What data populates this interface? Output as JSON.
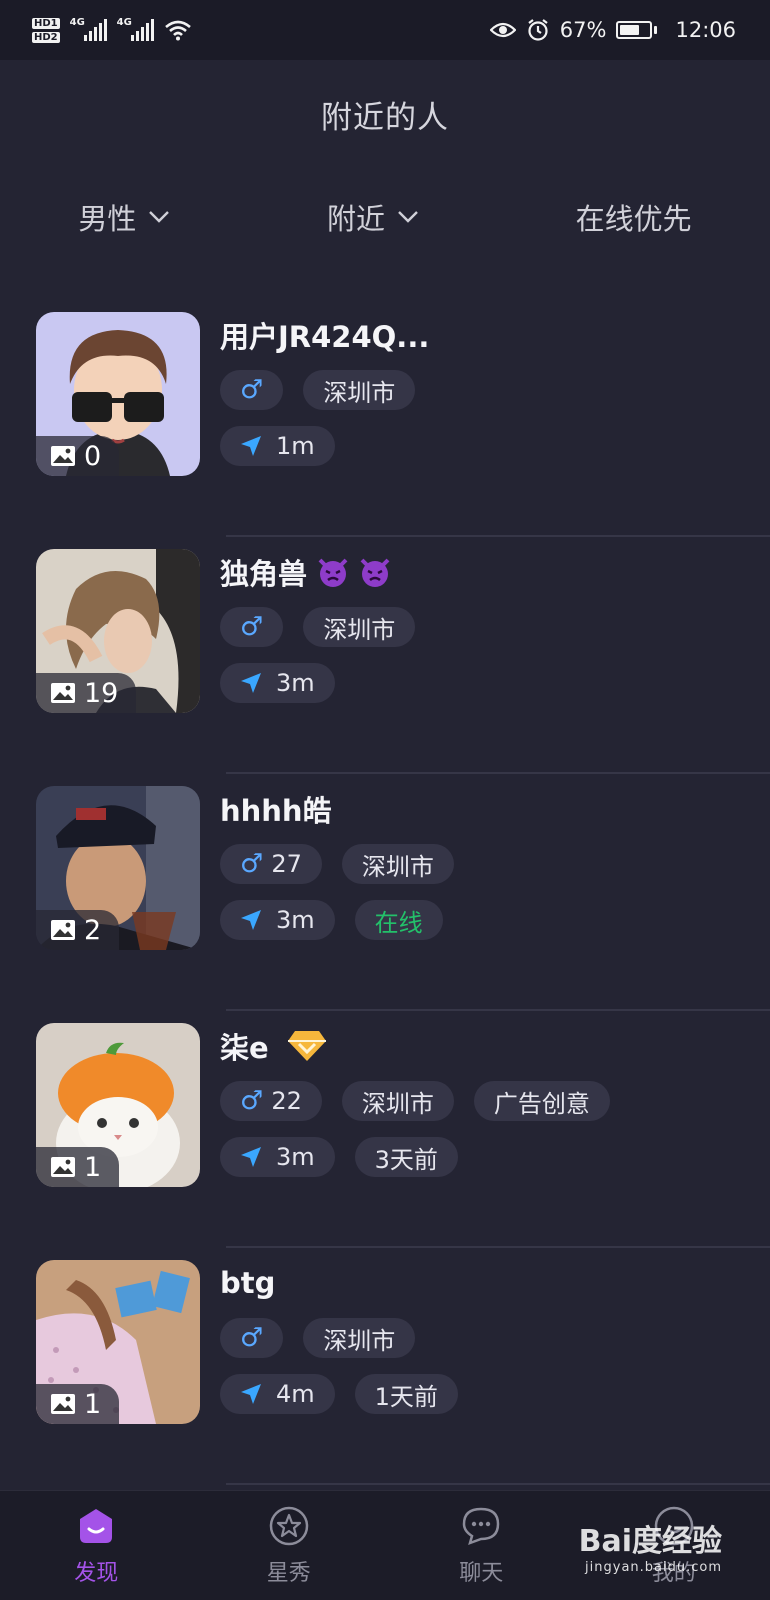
{
  "status_bar": {
    "network_1": "4G",
    "network_2": "4G",
    "hd_1": "HD1",
    "hd_2": "HD2",
    "battery": "67%",
    "battery_level": 0.67,
    "time": "12:06"
  },
  "header": {
    "title": "附近的人"
  },
  "filters": {
    "gender": "男性",
    "distance": "附近",
    "sort": "在线优先"
  },
  "users": [
    {
      "name": "用户JR424Q...",
      "photo_count": "0",
      "gender": "♂",
      "age": "",
      "city": "深圳市",
      "distance": "1m",
      "status": "",
      "extra_tag": "",
      "avatar": "cartoon-sunglasses"
    },
    {
      "name": "独角兽",
      "photo_count": "19",
      "gender": "♂",
      "age": "",
      "city": "深圳市",
      "distance": "3m",
      "status": "",
      "extra_tag": "",
      "avatar": "portrait-hair",
      "emoji": "devil-emoji"
    },
    {
      "name": "hhhh皓",
      "photo_count": "2",
      "gender": "♂",
      "age": "27",
      "city": "深圳市",
      "distance": "3m",
      "status": "在线",
      "extra_tag": "",
      "avatar": "selfie-cap"
    },
    {
      "name": "柒e",
      "photo_count": "1",
      "gender": "♂",
      "age": "22",
      "city": "深圳市",
      "distance": "3m",
      "status": "3天前",
      "extra_tag": "广告创意",
      "avatar": "cat-orange-hat",
      "badge": "vip-diamond"
    },
    {
      "name": "btg",
      "photo_count": "1",
      "gender": "♂",
      "age": "",
      "city": "深圳市",
      "distance": "4m",
      "status": "1天前",
      "extra_tag": "",
      "avatar": "bed-photo"
    }
  ],
  "tabs": [
    {
      "label": "发现",
      "icon": "discover-icon",
      "active": true
    },
    {
      "label": "星秀",
      "icon": "star-icon",
      "active": false
    },
    {
      "label": "聊天",
      "icon": "chat-icon",
      "active": false
    },
    {
      "label": "我的",
      "icon": "profile-icon",
      "active": false
    }
  ],
  "watermark": {
    "brand": "Bai度经验",
    "url": "jingyan.baidu.com"
  },
  "colors": {
    "accent": "#a453e8",
    "online": "#23c16a",
    "gender": "#5aa8ff",
    "location": "#3aa7ff"
  }
}
